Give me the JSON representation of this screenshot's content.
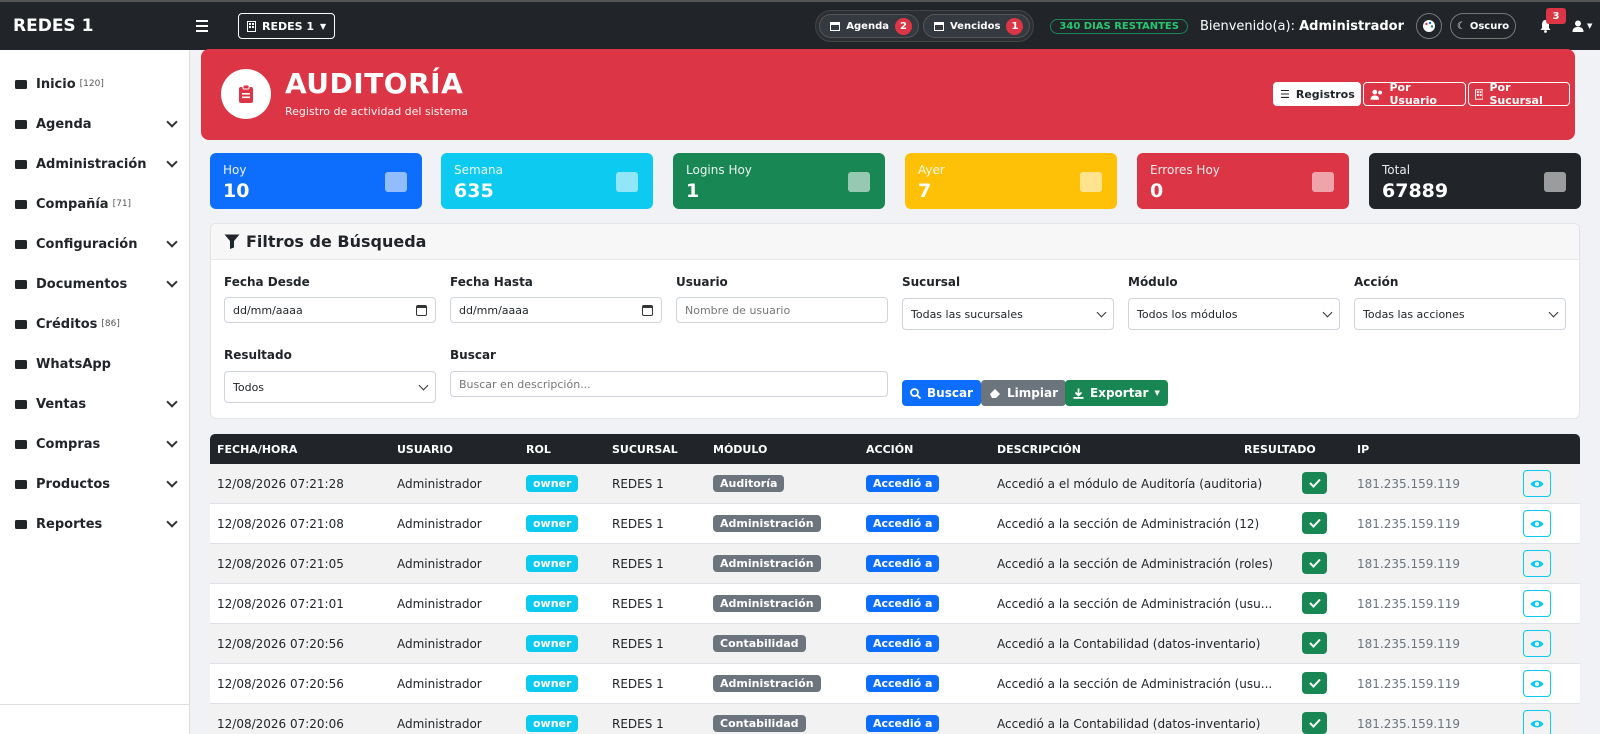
{
  "topbar": {
    "brand": "REDES 1",
    "branch": "REDES 1",
    "agenda_label": "Agenda",
    "agenda_count": "2",
    "vencidos_label": "Vencidos",
    "vencidos_count": "1",
    "days_remaining": "340 DIAS RESTANTES",
    "welcome_prefix": "Bienvenido(a):",
    "welcome_user": "Administrador",
    "theme_label": "Oscuro",
    "notif_count": "3"
  },
  "sidebar": {
    "items": [
      {
        "label": "Inicio",
        "count": "[120]",
        "icon": "home-icon",
        "expand": false
      },
      {
        "label": "Agenda",
        "count": "",
        "icon": "calendar-icon",
        "expand": true
      },
      {
        "label": "Administración",
        "count": "",
        "icon": "id-card-icon",
        "expand": true
      },
      {
        "label": "Compañía",
        "count": "[71]",
        "icon": "building-icon",
        "expand": false
      },
      {
        "label": "Configuración",
        "count": "",
        "icon": "gears-icon",
        "expand": true
      },
      {
        "label": "Documentos",
        "count": "",
        "icon": "folder-icon",
        "expand": true
      },
      {
        "label": "Créditos",
        "count": "[86]",
        "icon": "credit-card-icon",
        "expand": false
      },
      {
        "label": "WhatsApp",
        "count": "",
        "icon": "whatsapp-icon",
        "expand": false
      },
      {
        "label": "Ventas",
        "count": "",
        "icon": "cash-register-icon",
        "expand": true
      },
      {
        "label": "Compras",
        "count": "",
        "icon": "cart-icon",
        "expand": true
      },
      {
        "label": "Productos",
        "count": "",
        "icon": "boxes-icon",
        "expand": true
      },
      {
        "label": "Reportes",
        "count": "",
        "icon": "chart-icon",
        "expand": true
      }
    ]
  },
  "header": {
    "title": "AUDITORÍA",
    "subtitle": "Registro de actividad del sistema",
    "btn_registros": "Registros",
    "btn_por_usuario": "Por Usuario",
    "btn_por_sucursal": "Por Sucursal"
  },
  "stats": [
    {
      "label": "Hoy",
      "value": "10",
      "color": "#0d6efd",
      "icon": "calendar-icon"
    },
    {
      "label": "Semana",
      "value": "635",
      "color": "#0dcaf0",
      "icon": "calendar-week-icon"
    },
    {
      "label": "Logins Hoy",
      "value": "1",
      "color": "#198754",
      "icon": "sign-in-icon"
    },
    {
      "label": "Ayer",
      "value": "7",
      "color": "#ffc107",
      "icon": "clock-icon"
    },
    {
      "label": "Errores Hoy",
      "value": "0",
      "color": "#dc3545",
      "icon": "warning-icon"
    },
    {
      "label": "Total",
      "value": "67889",
      "color": "#212529",
      "icon": "database-icon"
    }
  ],
  "filters": {
    "title": "Filtros de Búsqueda",
    "fecha_desde_label": "Fecha Desde",
    "fecha_desde_value": "dd/mm/aaaa",
    "fecha_hasta_label": "Fecha Hasta",
    "fecha_hasta_value": "dd/mm/aaaa",
    "usuario_label": "Usuario",
    "usuario_placeholder": "Nombre de usuario",
    "sucursal_label": "Sucursal",
    "sucursal_value": "Todas las sucursales",
    "modulo_label": "Módulo",
    "modulo_value": "Todos los módulos",
    "accion_label": "Acción",
    "accion_value": "Todas las acciones",
    "resultado_label": "Resultado",
    "resultado_value": "Todos",
    "buscar_label": "Buscar",
    "buscar_placeholder": "Buscar en descripción...",
    "btn_buscar": "Buscar",
    "btn_limpiar": "Limpiar",
    "btn_exportar": "Exportar"
  },
  "table": {
    "headers": [
      "FECHA/HORA",
      "USUARIO",
      "ROL",
      "SUCURSAL",
      "MÓDULO",
      "ACCIÓN",
      "DESCRIPCIÓN",
      "RESULTADO",
      "IP"
    ],
    "rows": [
      {
        "fecha": "12/08/2026 07:21:28",
        "usuario": "Administrador",
        "rol": "owner",
        "sucursal": "REDES 1",
        "modulo": "Auditoría",
        "accion": "Accedió a",
        "descripcion": "Accedió a el módulo de Auditoría (auditoria)",
        "ip": "181.235.159.119"
      },
      {
        "fecha": "12/08/2026 07:21:08",
        "usuario": "Administrador",
        "rol": "owner",
        "sucursal": "REDES 1",
        "modulo": "Administración",
        "accion": "Accedió a",
        "descripcion": "Accedió a la sección de Administración (12)",
        "ip": "181.235.159.119"
      },
      {
        "fecha": "12/08/2026 07:21:05",
        "usuario": "Administrador",
        "rol": "owner",
        "sucursal": "REDES 1",
        "modulo": "Administración",
        "accion": "Accedió a",
        "descripcion": "Accedió a la sección de Administración (roles)",
        "ip": "181.235.159.119"
      },
      {
        "fecha": "12/08/2026 07:21:01",
        "usuario": "Administrador",
        "rol": "owner",
        "sucursal": "REDES 1",
        "modulo": "Administración",
        "accion": "Accedió a",
        "descripcion": "Accedió a la sección de Administración (usu...",
        "ip": "181.235.159.119"
      },
      {
        "fecha": "12/08/2026 07:20:56",
        "usuario": "Administrador",
        "rol": "owner",
        "sucursal": "REDES 1",
        "modulo": "Contabilidad",
        "accion": "Accedió a",
        "descripcion": "Accedió a la Contabilidad (datos-inventario)",
        "ip": "181.235.159.119"
      },
      {
        "fecha": "12/08/2026 07:20:56",
        "usuario": "Administrador",
        "rol": "owner",
        "sucursal": "REDES 1",
        "modulo": "Administración",
        "accion": "Accedió a",
        "descripcion": "Accedió a la sección de Administración (usu...",
        "ip": "181.235.159.119"
      },
      {
        "fecha": "12/08/2026 07:20:06",
        "usuario": "Administrador",
        "rol": "owner",
        "sucursal": "REDES 1",
        "modulo": "Contabilidad",
        "accion": "Accedió a",
        "descripcion": "Accedió a la Contabilidad (datos-inventario)",
        "ip": "181.235.159.119"
      }
    ]
  }
}
